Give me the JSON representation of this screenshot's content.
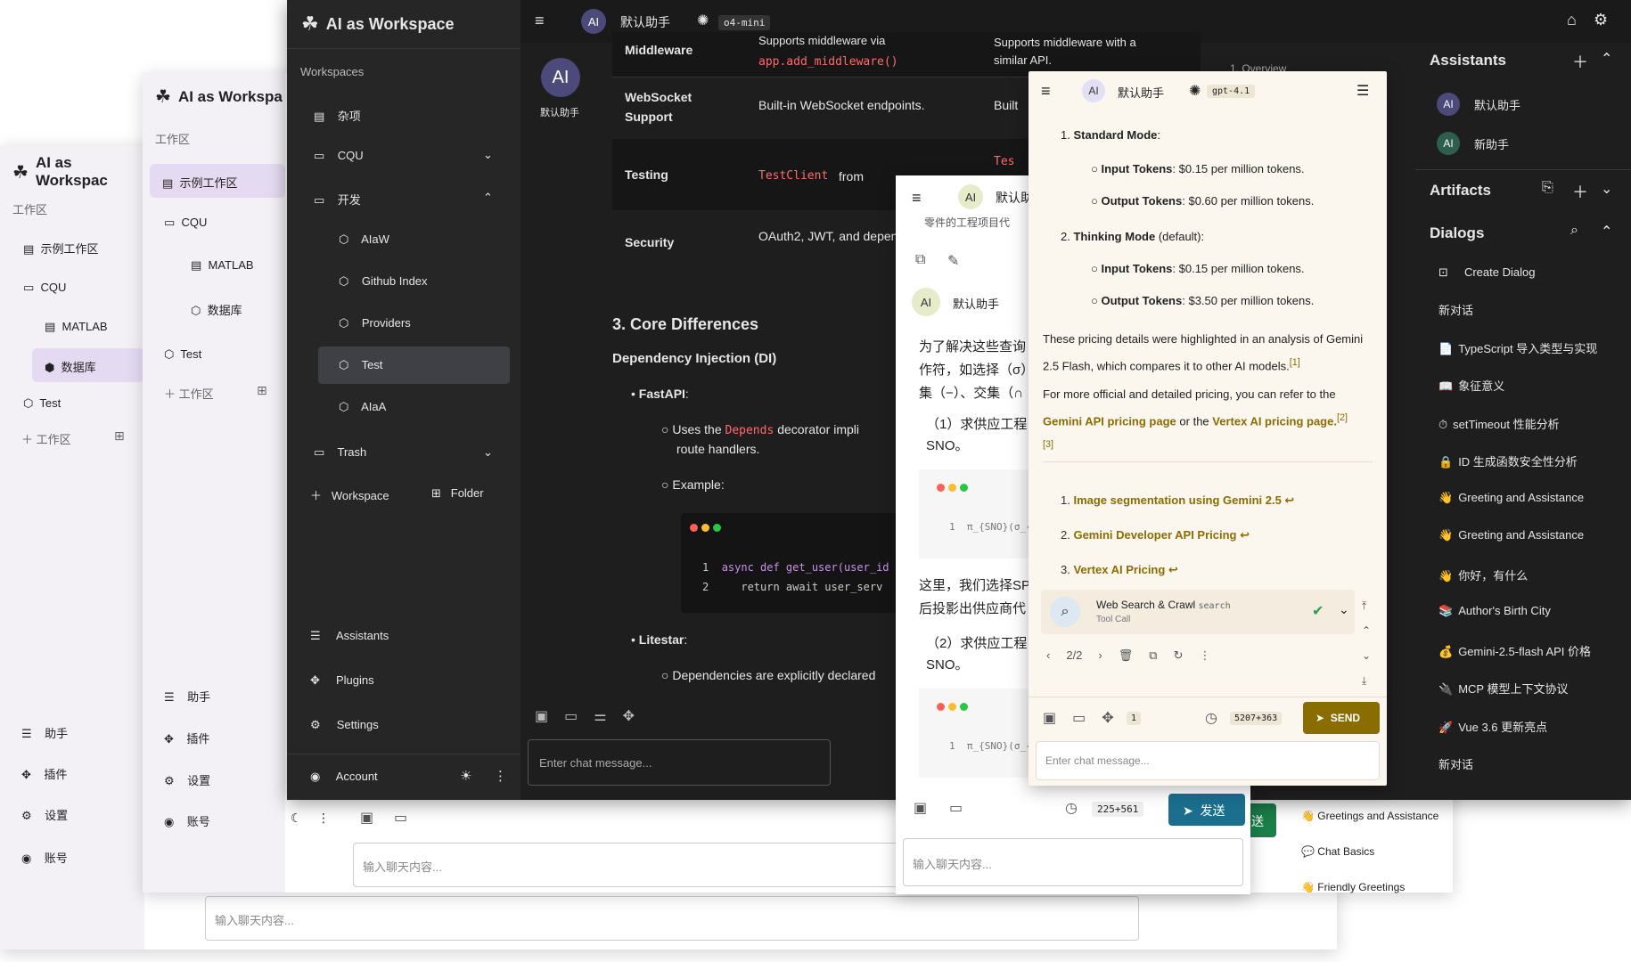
{
  "app": {
    "title": "AI as Workspace",
    "title_short": "AI as Workspac",
    "title_mid": "AI as Workspa"
  },
  "win1": {
    "workspace_header": "工作区",
    "tree": [
      {
        "label": "示例工作区",
        "icon": "book-icon"
      },
      {
        "label": "CQU",
        "icon": "folder-icon"
      },
      {
        "label": "MATLAB",
        "icon": "book-icon"
      },
      {
        "label": "数据库",
        "icon": "cube-icon"
      },
      {
        "label": "Test",
        "icon": "cube-icon"
      }
    ],
    "add_workspace": "工作区",
    "nav": [
      "助手",
      "插件",
      "设置"
    ],
    "account": "账号",
    "input_placeholder": "输入聊天内容..."
  },
  "win2": {
    "workspace_header": "工作区",
    "tree": [
      {
        "label": "示例工作区",
        "icon": "book-icon"
      },
      {
        "label": "CQU",
        "icon": "folder-icon"
      },
      {
        "label": "MATLAB",
        "icon": "book-icon"
      },
      {
        "label": "数据库",
        "icon": "cube-icon"
      },
      {
        "label": "Test",
        "icon": "cube-icon"
      }
    ],
    "add_workspace": "工作区",
    "nav": [
      "助手",
      "插件",
      "设置"
    ],
    "account": "账号",
    "input_placeholder": "输入聊天内容...",
    "dialogs": [
      "Greetings and Assistance",
      "Chat Basics",
      "Friendly Greetings"
    ]
  },
  "win3": {
    "workspaces_header": "Workspaces",
    "tree": [
      {
        "label": "杂项",
        "icon": "book-icon"
      },
      {
        "label": "CQU",
        "icon": "folder-icon"
      },
      {
        "label": "开发",
        "icon": "folder-icon"
      },
      {
        "label": "AIaW",
        "icon": "cube-icon"
      },
      {
        "label": "Github Index",
        "icon": "cube-icon"
      },
      {
        "label": "Providers",
        "icon": "cube-icon"
      },
      {
        "label": "Test",
        "icon": "cube-icon"
      },
      {
        "label": "AIaA",
        "icon": "cube-icon"
      },
      {
        "label": "Trash",
        "icon": "folder-icon"
      }
    ],
    "add_workspace": "Workspace",
    "add_folder": "Folder",
    "nav": [
      "Assistants",
      "Plugins",
      "Settings"
    ],
    "account": "Account",
    "assistant_name": "默认助手",
    "model": "o4-mini",
    "avatar": "AI",
    "table": [
      {
        "feature": "Middleware",
        "a": "Supports middleware via",
        "a_code": "app.add_middleware()",
        "b": "Supports middleware with a similar API."
      },
      {
        "feature": "WebSocket Support",
        "a": "Built-in WebSocket endpoints.",
        "b": "Built"
      },
      {
        "feature": "Testing",
        "a_code": "TestClient",
        "a": "from",
        "b_code": "Tes"
      },
      {
        "feature": "Security",
        "a": "OAuth2, JWT, and dependencies.",
        "b": ""
      }
    ],
    "h3": "3. Core Differences",
    "h4": "Dependency Injection (DI)",
    "fastapi": "FastAPI",
    "uses": "Uses the",
    "depends": "Depends",
    "decorator": "decorator impli",
    "route": "route handlers.",
    "example": "Example:",
    "code1": "async def get_user(user_id",
    "code2": "return await user_serv",
    "litestar": "Litestar",
    "deps": "Dependencies are explicitly declared",
    "toc": "1. Overview",
    "input_placeholder": "Enter chat message...",
    "assistants_title": "Assistants",
    "assistants": [
      {
        "name": "默认助手",
        "avatar": "AI"
      },
      {
        "name": "新助手",
        "avatar": "AI"
      }
    ],
    "artifacts_title": "Artifacts",
    "dialogs_title": "Dialogs",
    "create_dialog": "Create Dialog",
    "dialogs": [
      {
        "emoji": "",
        "title": "新对话"
      },
      {
        "emoji": "📄",
        "title": "TypeScript 导入类型与实现"
      },
      {
        "emoji": "📖",
        "title": "象征意义"
      },
      {
        "emoji": "⏱",
        "title": "setTimeout 性能分析"
      },
      {
        "emoji": "🔒",
        "title": "ID 生成函数安全性分析"
      },
      {
        "emoji": "👋",
        "title": "Greeting and Assistance"
      },
      {
        "emoji": "👋",
        "title": "Greeting and Assistance"
      },
      {
        "emoji": "👋",
        "title": "你好，有什么"
      },
      {
        "emoji": "📚",
        "title": "Author's Birth City"
      },
      {
        "emoji": "💰",
        "title": "Gemini-2.5-flash API 价格"
      },
      {
        "emoji": "🔌",
        "title": "MCP 模型上下文协议"
      },
      {
        "emoji": "🚀",
        "title": "Vue 3.6 更新亮点"
      },
      {
        "emoji": "",
        "title": "新对话"
      }
    ]
  },
  "win4": {
    "assistant_name": "默认助",
    "avatar": "AI",
    "top_text": "零件的工程项目代",
    "msg_author": "默认助手",
    "p1": "为了解决这些查询",
    "p2": "作符，如选择（σ）",
    "p3": "集（−）、交集（∩",
    "q1": "（1）求供应工程",
    "q1b": "SNO。",
    "code_line": "π_{SNO}(σ_{",
    "p4": "这里，我们选择SP",
    "p5": "后投影出供应商代",
    "q2": "（2）求供应工程",
    "q2b": "SNO。",
    "code_line2": "π_{SNO}(σ_{",
    "tokens": "225+561",
    "send": "发送",
    "input_placeholder": "输入聊天内容..."
  },
  "win5": {
    "assistant_name": "默认助手",
    "avatar": "AI",
    "model": "gpt-4.1",
    "standard": "Standard Mode",
    "thinking": "Thinking Mode",
    "default": "(default):",
    "in1": "Input Tokens",
    "in1v": ": $0.15 per million tokens.",
    "out1": "Output Tokens",
    "out1v": ": $0.60 per million tokens.",
    "in2": "Input Tokens",
    "in2v": ": $0.15 per million tokens.",
    "out2": "Output Tokens",
    "out2v": ": $3.50 per million tokens.",
    "para1": "These pricing details were highlighted in an analysis of Gemini 2.5 Flash, which compares it to other AI models.",
    "para2a": "For more official and detailed pricing, you can refer to the",
    "link1": "Gemini API pricing page",
    "or": "or the",
    "link2": "Vertex AI pricing page.",
    "refs": [
      "Image segmentation using Gemini 2.5",
      "Gemini Developer API Pricing",
      "Vertex AI Pricing"
    ],
    "tool_title": "Web Search & Crawl",
    "tool_tag": "search",
    "tool_sub": "Tool Call",
    "pager": "2/2",
    "plugins_count": "1",
    "tokens": "5207+363",
    "send": "SEND",
    "input_placeholder": "Enter chat message..."
  }
}
